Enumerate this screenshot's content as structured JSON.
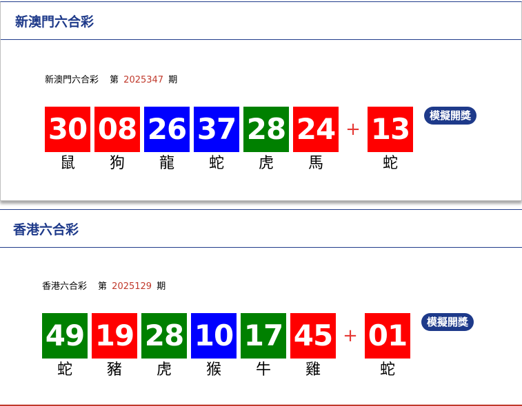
{
  "panels": [
    {
      "title": "新澳門六合彩",
      "lotto_name": "新澳門六合彩",
      "issue_prefix": "第",
      "issue_number": "2025347",
      "issue_suffix": "期",
      "balls": [
        {
          "number": "30",
          "zodiac": "鼠",
          "color": "#ff0000"
        },
        {
          "number": "08",
          "zodiac": "狗",
          "color": "#ff0000"
        },
        {
          "number": "26",
          "zodiac": "龍",
          "color": "#0000ff"
        },
        {
          "number": "37",
          "zodiac": "蛇",
          "color": "#0000ff"
        },
        {
          "number": "28",
          "zodiac": "虎",
          "color": "#008000"
        },
        {
          "number": "24",
          "zodiac": "馬",
          "color": "#ff0000"
        }
      ],
      "plus_sign": "+",
      "special_ball": {
        "number": "13",
        "zodiac": "蛇",
        "color": "#ff0000"
      },
      "simulate_button_label": "模擬開獎"
    },
    {
      "title": "香港六合彩",
      "lotto_name": "香港六合彩",
      "issue_prefix": "第",
      "issue_number": "2025129",
      "issue_suffix": "期",
      "balls": [
        {
          "number": "49",
          "zodiac": "蛇",
          "color": "#008000"
        },
        {
          "number": "19",
          "zodiac": "豬",
          "color": "#ff0000"
        },
        {
          "number": "28",
          "zodiac": "虎",
          "color": "#008000"
        },
        {
          "number": "10",
          "zodiac": "猴",
          "color": "#0000ff"
        },
        {
          "number": "17",
          "zodiac": "牛",
          "color": "#008000"
        },
        {
          "number": "45",
          "zodiac": "雞",
          "color": "#ff0000"
        }
      ],
      "plus_sign": "+",
      "special_ball": {
        "number": "01",
        "zodiac": "蛇",
        "color": "#ff0000"
      },
      "simulate_button_label": "模擬開獎"
    }
  ],
  "colors": {
    "accent_blue": "#1e3a8a",
    "issue_red": "#c0392b",
    "plus_red": "#e53935"
  }
}
